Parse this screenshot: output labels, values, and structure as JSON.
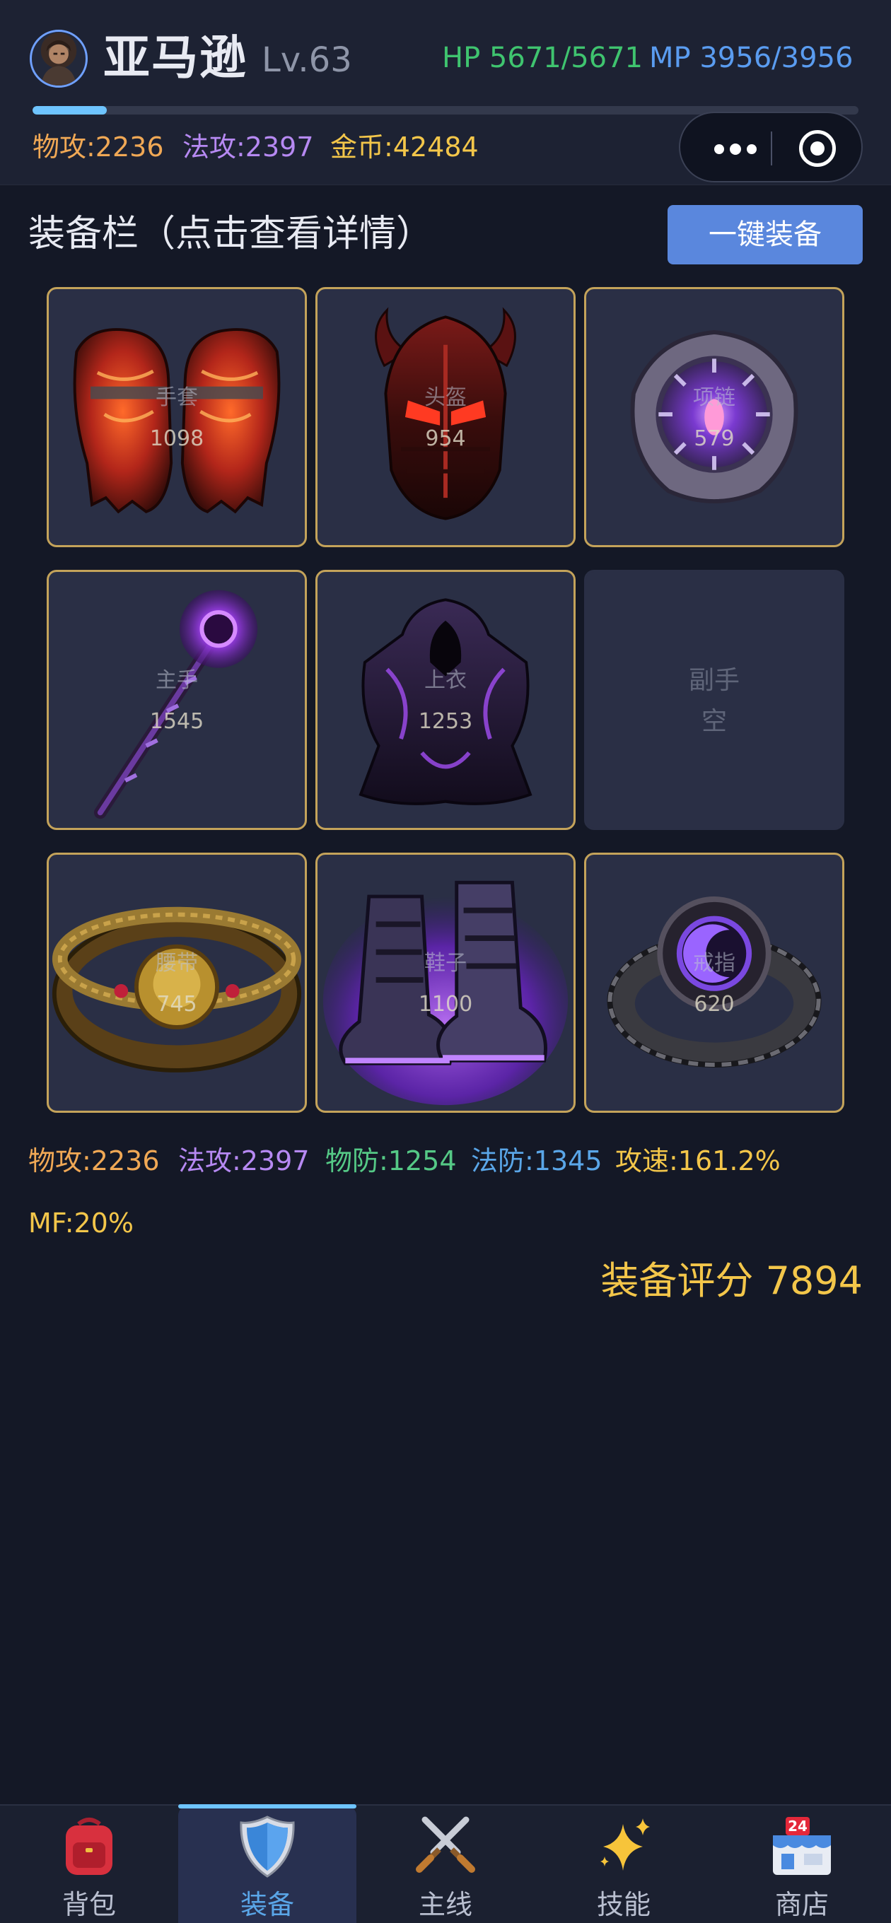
{
  "header": {
    "name": "亚马逊",
    "level": "Lv.63",
    "hp": "HP 5671/5671",
    "mp": "MP 3956/3956",
    "xp_fraction": 0.09,
    "stats": {
      "atk": "物攻:2236",
      "matk": "法攻:2397",
      "gold": "金币:42484"
    },
    "capsule_icons": [
      "more-icon",
      "target-icon"
    ]
  },
  "section": {
    "title": "装备栏（点击查看详情）",
    "equip_all": "一键装备"
  },
  "slots": [
    {
      "label": "手套",
      "power": "1098",
      "icon": "gauntlets-icon"
    },
    {
      "label": "头盔",
      "power": "954",
      "icon": "helmet-icon"
    },
    {
      "label": "项链",
      "power": "579",
      "icon": "amulet-icon"
    },
    {
      "label": "主手",
      "power": "1545",
      "icon": "staff-icon"
    },
    {
      "label": "上衣",
      "power": "1253",
      "icon": "robe-icon"
    },
    {
      "label": "副手",
      "power": "空",
      "icon": ""
    },
    {
      "label": "腰带",
      "power": "745",
      "icon": "belt-icon"
    },
    {
      "label": "鞋子",
      "power": "1100",
      "icon": "boots-icon"
    },
    {
      "label": "戒指",
      "power": "620",
      "icon": "ring-icon"
    }
  ],
  "stats": {
    "atk": "物攻:2236",
    "matk": "法攻:2397",
    "pdef": "物防:1254",
    "mdef": "法防:1345",
    "aspd": "攻速:161.2%",
    "mf": "MF:20%"
  },
  "score": "装备评分 7894",
  "nav": [
    {
      "label": "背包",
      "icon": "backpack-icon"
    },
    {
      "label": "装备",
      "icon": "shield-icon"
    },
    {
      "label": "主线",
      "icon": "crossed-swords-icon"
    },
    {
      "label": "技能",
      "icon": "sparkles-icon"
    },
    {
      "label": "商店",
      "icon": "store-icon",
      "badge": "24"
    }
  ],
  "colors": {
    "background": "#141826",
    "accent_blue": "#5a87dd",
    "gold": "#f3c64a",
    "hp_green": "#3fc46f",
    "mp_blue": "#5a9cf0",
    "slot_border": "#c4a35a"
  }
}
